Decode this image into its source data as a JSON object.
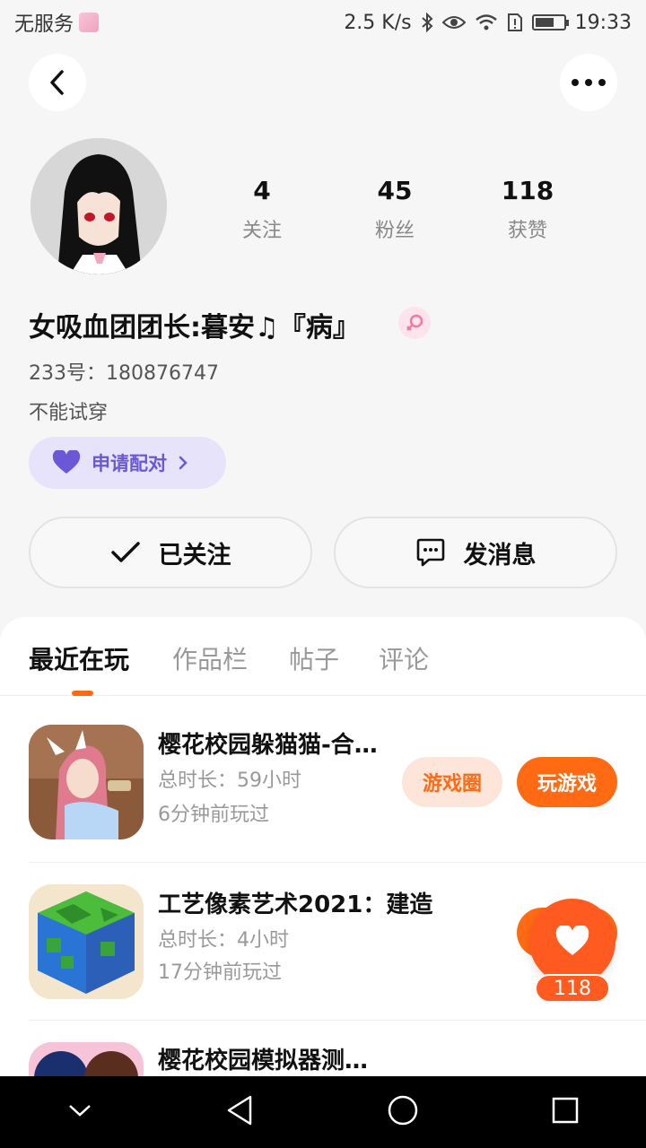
{
  "status_bar": {
    "carrier": "无服务",
    "speed": "2.5 K/s",
    "time": "19:33"
  },
  "profile": {
    "stats": [
      {
        "value": "4",
        "label": "关注"
      },
      {
        "value": "45",
        "label": "粉丝"
      },
      {
        "value": "118",
        "label": "获赞"
      }
    ],
    "nickname": "女吸血团团长:暮安♫『病』",
    "uid": "233号：180876747",
    "bio": "不能试穿",
    "pair_label": "申请配对",
    "follow_label": "已关注",
    "message_label": "发消息"
  },
  "tabs": [
    "最近在玩",
    "作品栏",
    "帖子",
    "评论"
  ],
  "games": [
    {
      "title": "樱花校园躲猫猫-合…",
      "duration": "总时长：59小时",
      "last_played": "6分钟前玩过",
      "circle_label": "游戏圈",
      "play_label": "玩游戏"
    },
    {
      "title": "工艺像素艺术2021：建造",
      "duration": "总时长：4小时",
      "last_played": "17分钟前玩过"
    },
    {
      "title": "樱花校园模拟器测…"
    }
  ],
  "like": {
    "count": "118"
  },
  "colors": {
    "accent": "#ff6a13",
    "purple": "#6a58d6"
  }
}
